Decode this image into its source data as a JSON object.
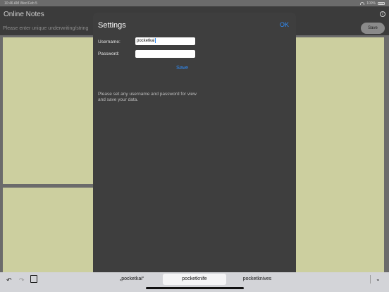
{
  "status_bar": {
    "time": "10:46 AM",
    "date": "Wed Feb 5",
    "battery": "100%"
  },
  "app": {
    "title": "Online Notes",
    "input_placeholder": "Please enter unique underwriting/string",
    "save_label": "Save",
    "info_label": "i"
  },
  "settings": {
    "title": "Settings",
    "ok_label": "OK",
    "username_label": "Username:",
    "username_value": "pocketkai",
    "password_label": "Password:",
    "password_value": "",
    "save_label": "Save",
    "hint": "Please set any username and password for view and save your data."
  },
  "keyboard": {
    "suggestions": [
      "„pocketkai“",
      "pocketknife",
      "pocketknives"
    ],
    "undo_icon": "undo-icon",
    "redo_icon": "redo-icon",
    "paste_icon": "paste-icon",
    "dismiss_icon": "chevron-down-icon"
  },
  "colors": {
    "accent": "#2f8dfa",
    "note": "#cccf9f",
    "modal": "#3e3e3e"
  }
}
